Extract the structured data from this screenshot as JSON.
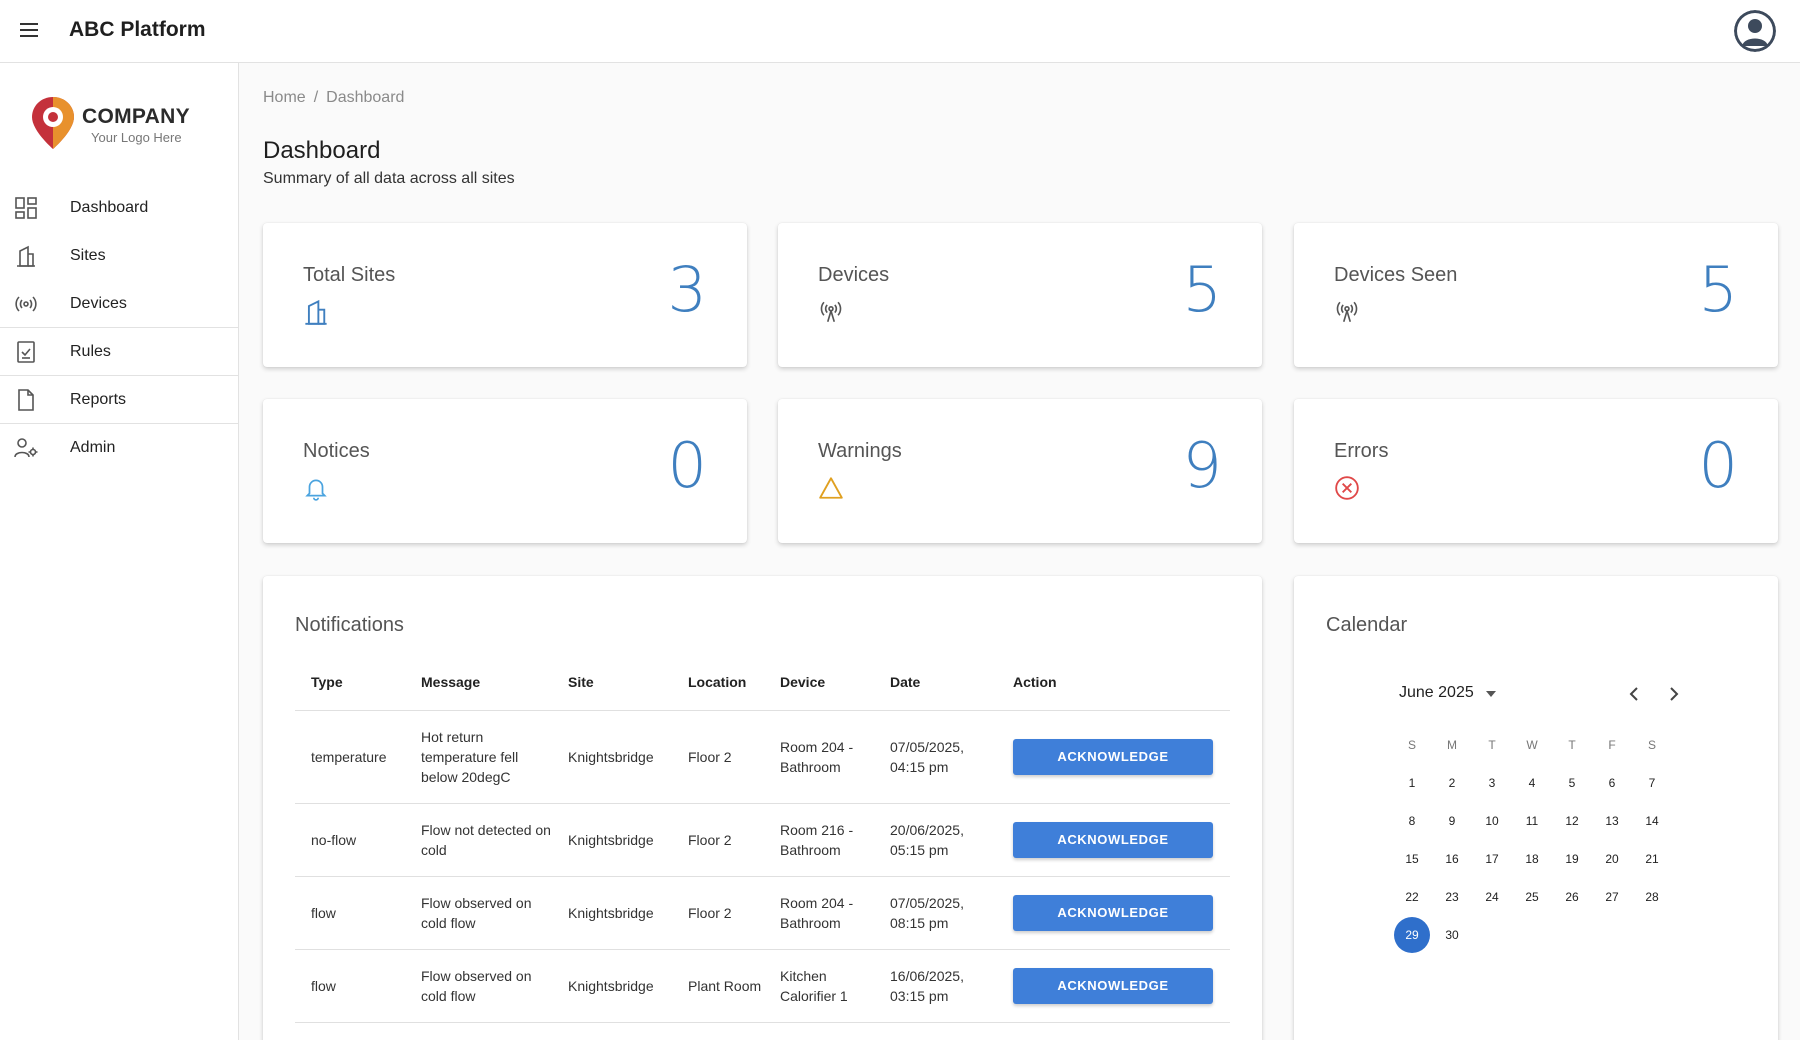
{
  "header": {
    "title": "ABC Platform"
  },
  "logo": {
    "name": "COMPANY",
    "tagline": "Your Logo Here"
  },
  "sidebar": {
    "items": [
      {
        "label": "Dashboard",
        "icon": "dashboard-grid-icon"
      },
      {
        "label": "Sites",
        "icon": "building-icon"
      },
      {
        "label": "Devices",
        "icon": "broadcast-icon"
      },
      {
        "label": "Rules",
        "icon": "checklist-icon"
      },
      {
        "label": "Reports",
        "icon": "document-icon"
      },
      {
        "label": "Admin",
        "icon": "user-settings-icon"
      }
    ]
  },
  "breadcrumb": {
    "home": "Home",
    "separator": "/",
    "current": "Dashboard"
  },
  "page": {
    "title": "Dashboard",
    "subtitle": "Summary of all data across all sites"
  },
  "stats": [
    {
      "label": "Total Sites",
      "value": "3",
      "icon": "building-icon"
    },
    {
      "label": "Devices",
      "value": "5",
      "icon": "broadcast-icon"
    },
    {
      "label": "Devices Seen",
      "value": "5",
      "icon": "broadcast-icon"
    },
    {
      "label": "Notices",
      "value": "0",
      "icon": "bell-icon"
    },
    {
      "label": "Warnings",
      "value": "9",
      "icon": "warning-icon"
    },
    {
      "label": "Errors",
      "value": "0",
      "icon": "error-icon"
    }
  ],
  "notifications": {
    "title": "Notifications",
    "columns": [
      "Type",
      "Message",
      "Site",
      "Location",
      "Device",
      "Date",
      "Action"
    ],
    "rows": [
      {
        "type": "temperature",
        "message": "Hot return temperature fell below 20degC",
        "site": "Knightsbridge",
        "location": "Floor 2",
        "device": "Room 204 - Bathroom",
        "date": "07/05/2025, 04:15 pm",
        "action": "ACKNOWLEDGE"
      },
      {
        "type": "no-flow",
        "message": "Flow not detected on cold",
        "site": "Knightsbridge",
        "location": "Floor 2",
        "device": "Room 216 - Bathroom",
        "date": "20/06/2025, 05:15 pm",
        "action": "ACKNOWLEDGE"
      },
      {
        "type": "flow",
        "message": "Flow observed on cold flow",
        "site": "Knightsbridge",
        "location": "Floor 2",
        "device": "Room 204 - Bathroom",
        "date": "07/05/2025, 08:15 pm",
        "action": "ACKNOWLEDGE"
      },
      {
        "type": "flow",
        "message": "Flow observed on cold flow",
        "site": "Knightsbridge",
        "location": "Plant Room",
        "device": "Kitchen Calorifier 1",
        "date": "16/06/2025, 03:15 pm",
        "action": "ACKNOWLEDGE"
      }
    ]
  },
  "calendar": {
    "title": "Calendar",
    "month_label": "June 2025",
    "weekdays": [
      "S",
      "M",
      "T",
      "W",
      "T",
      "F",
      "S"
    ],
    "weeks": [
      [
        "1",
        "2",
        "3",
        "4",
        "5",
        "6",
        "7"
      ],
      [
        "8",
        "9",
        "10",
        "11",
        "12",
        "13",
        "14"
      ],
      [
        "15",
        "16",
        "17",
        "18",
        "19",
        "20",
        "21"
      ],
      [
        "22",
        "23",
        "24",
        "25",
        "26",
        "27",
        "28"
      ],
      [
        "29",
        "30",
        "",
        "",
        "",
        "",
        ""
      ]
    ],
    "selected": "29",
    "colors": {
      "selected": "#2f6fcb"
    }
  },
  "colors": {
    "accent": "#3f7fd9",
    "stat_value": "#3f7fbf",
    "notice": "#4aa3df",
    "warning": "#e0a020",
    "error": "#e04848"
  }
}
